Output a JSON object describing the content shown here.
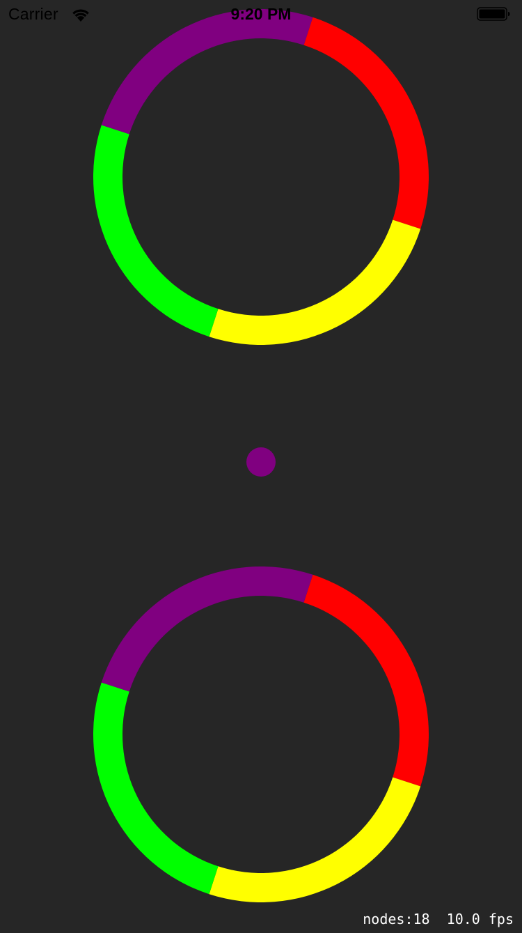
{
  "status_bar": {
    "carrier": "Carrier",
    "time": "9:20 PM",
    "wifi_icon": "wifi-icon",
    "battery_icon": "battery-icon"
  },
  "colors": {
    "background": "#262626",
    "red": "#ff0000",
    "yellow": "#ffff00",
    "green": "#00ff00",
    "purple": "#800080"
  },
  "game": {
    "ball_color": "purple",
    "rings": [
      {
        "segments": [
          {
            "color": "red",
            "label": "red"
          },
          {
            "color": "yellow",
            "label": "yellow"
          },
          {
            "color": "green",
            "label": "green"
          },
          {
            "color": "purple",
            "label": "purple"
          }
        ]
      },
      {
        "segments": [
          {
            "color": "red",
            "label": "red"
          },
          {
            "color": "yellow",
            "label": "yellow"
          },
          {
            "color": "green",
            "label": "green"
          },
          {
            "color": "purple",
            "label": "purple"
          }
        ]
      }
    ]
  },
  "debug": {
    "stats_text": "nodes:18  10.0 fps"
  }
}
